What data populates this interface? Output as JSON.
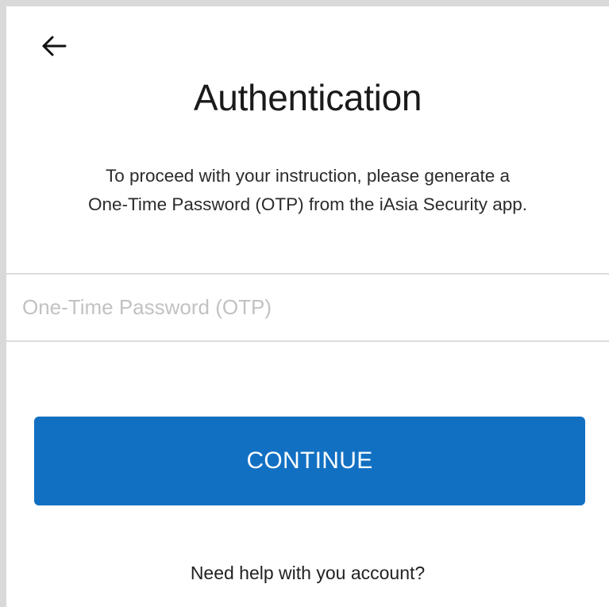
{
  "header": {
    "back_icon": "arrow-left-icon",
    "title": "Authentication"
  },
  "description": {
    "line1": "To proceed with your instruction, please generate a",
    "line2": "One-Time Password (OTP) from the iAsia Security app."
  },
  "otp_field": {
    "value": "",
    "placeholder": "One-Time Password (OTP)"
  },
  "actions": {
    "continue_label": "CONTINUE",
    "help_label": "Need help with you account?"
  },
  "colors": {
    "primary": "#1270c3",
    "background": "#ffffff",
    "frame": "#d9d9d9",
    "divider": "#dcdcdc",
    "placeholder": "#c2c2c2"
  }
}
